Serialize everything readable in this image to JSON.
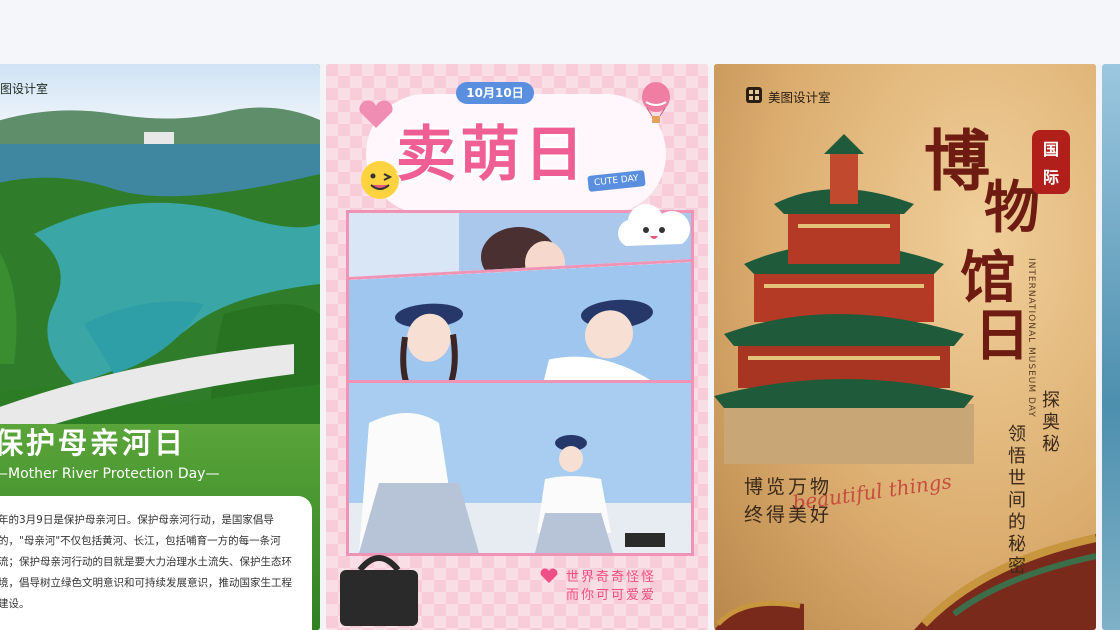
{
  "cards": [
    {
      "brand": "图设计室",
      "title": "保护母亲河日",
      "subtitle": "—Mother River Protection Day—",
      "body": "年的3月9日是保护母亲河日。保护母亲河行动，是国家倡导的，\"母亲河\"不仅包括黄河、长江，包括哺育一方的每一条河流；保护母亲河行动的目就是要大力治理水土流失、保护生态环境，倡导树立绿色文明意识和可持续发展意识，推动国家生工程建设。",
      "accent": "#3f8e2a"
    },
    {
      "date": "10月10日",
      "title": "卖萌日",
      "tag": "CUTE DAY",
      "footer_line1": "世界奇奇怪怪",
      "footer_line2": "而你可可爱爱",
      "accent": "#ef5f93"
    },
    {
      "brand": "美图设计室",
      "title_chars": [
        "博",
        "物",
        "馆",
        "日"
      ],
      "seal_chars": [
        "国",
        "际"
      ],
      "english": "INTERNATIONAL MUSEUM DAY",
      "vertical_1": "探奥秘",
      "vertical_2": "领悟世间的秘密",
      "headline_1": "博览万物",
      "headline_2": "终得美好",
      "script": "beautiful things",
      "accent": "#6e1b12"
    }
  ]
}
